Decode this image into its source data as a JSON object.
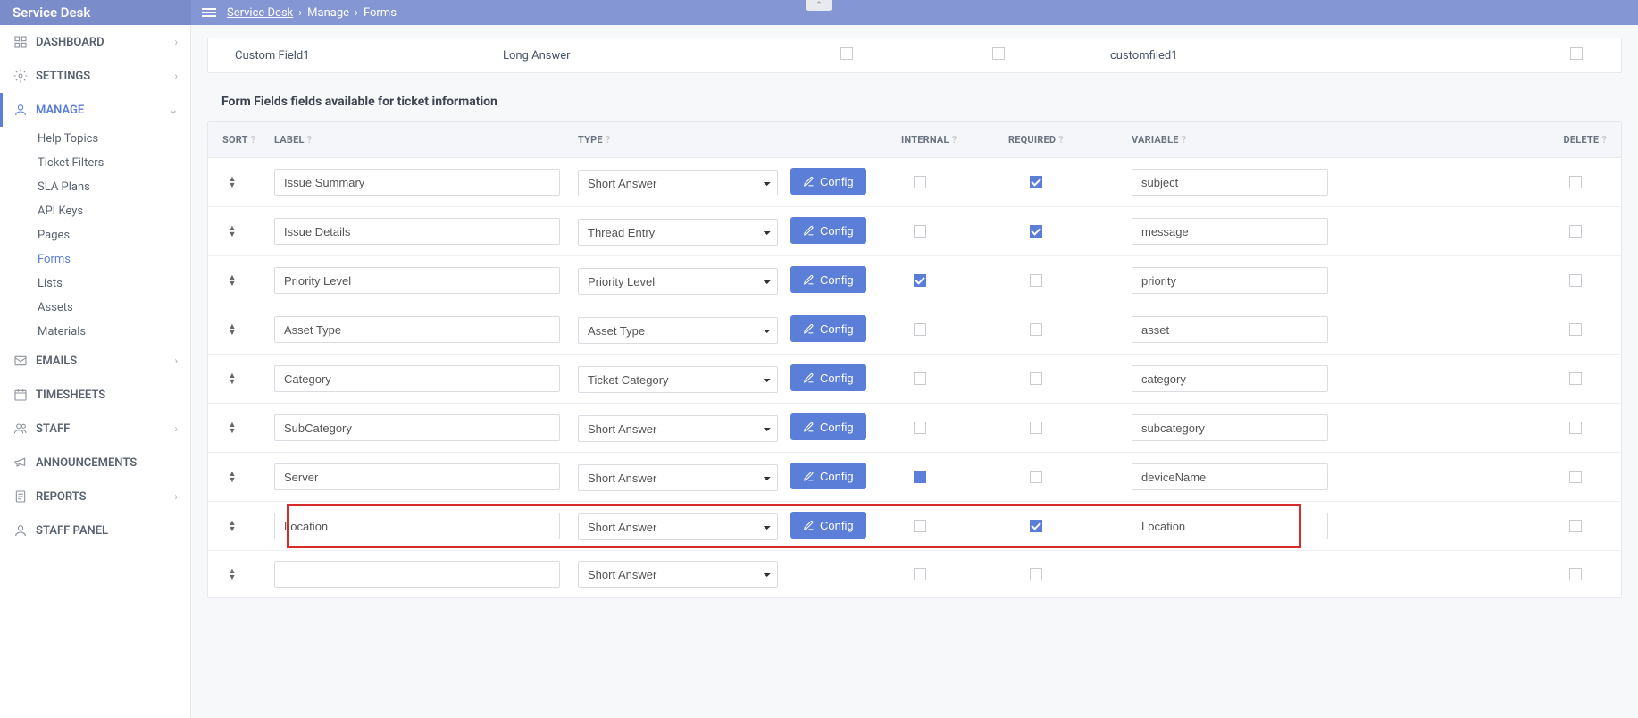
{
  "app_title": "Service Desk",
  "breadcrumb": {
    "root": "Service Desk",
    "mid": "Manage",
    "leaf": "Forms"
  },
  "sidebar": {
    "dashboard": "DASHBOARD",
    "settings": "SETTINGS",
    "manage": "MANAGE",
    "manage_items": {
      "help_topics": "Help Topics",
      "ticket_filters": "Ticket Filters",
      "sla_plans": "SLA Plans",
      "api_keys": "API Keys",
      "pages": "Pages",
      "forms": "Forms",
      "lists": "Lists",
      "assets": "Assets",
      "materials": "Materials"
    },
    "emails": "EMAILS",
    "timesheets": "TIMESHEETS",
    "staff": "STAFF",
    "announcements": "ANNOUNCEMENTS",
    "reports": "REPORTS",
    "staff_panel": "STAFF PANEL"
  },
  "top_row": {
    "label": "Custom Field1",
    "type": "Long Answer",
    "variable": "customfiled1"
  },
  "section_title": "Form Fields fields available for ticket information",
  "columns": {
    "sort": "SORT",
    "label": "LABEL",
    "type": "TYPE",
    "internal": "INTERNAL",
    "required": "REQUIRED",
    "variable": "VARIABLE",
    "delete": "DELETE"
  },
  "config_label": "Config",
  "rows": [
    {
      "label": "Issue Summary",
      "type": "Short Answer",
      "internal": false,
      "required": true,
      "variable": "subject",
      "highlight": false
    },
    {
      "label": "Issue Details",
      "type": "Thread Entry",
      "internal": false,
      "required": true,
      "variable": "message",
      "highlight": false
    },
    {
      "label": "Priority Level",
      "type": "Priority Level",
      "internal": true,
      "required": false,
      "variable": "priority",
      "highlight": false
    },
    {
      "label": "Asset Type",
      "type": "Asset Type",
      "internal": false,
      "required": false,
      "variable": "asset",
      "highlight": false
    },
    {
      "label": "Category",
      "type": "Ticket Category",
      "internal": false,
      "required": false,
      "variable": "category",
      "highlight": false
    },
    {
      "label": "SubCategory",
      "type": "Short Answer",
      "internal": false,
      "required": false,
      "variable": "subcategory",
      "highlight": false
    },
    {
      "label": "Server",
      "type": "Short Answer",
      "internal": "filled",
      "required": false,
      "variable": "deviceName",
      "highlight": false
    },
    {
      "label": "Location",
      "type": "Short Answer",
      "internal": false,
      "required": true,
      "variable": "Location",
      "highlight": true
    },
    {
      "label": "",
      "type": "Short Answer",
      "internal": false,
      "required": false,
      "variable": "",
      "no_config": true,
      "no_var": true,
      "highlight": false
    }
  ]
}
